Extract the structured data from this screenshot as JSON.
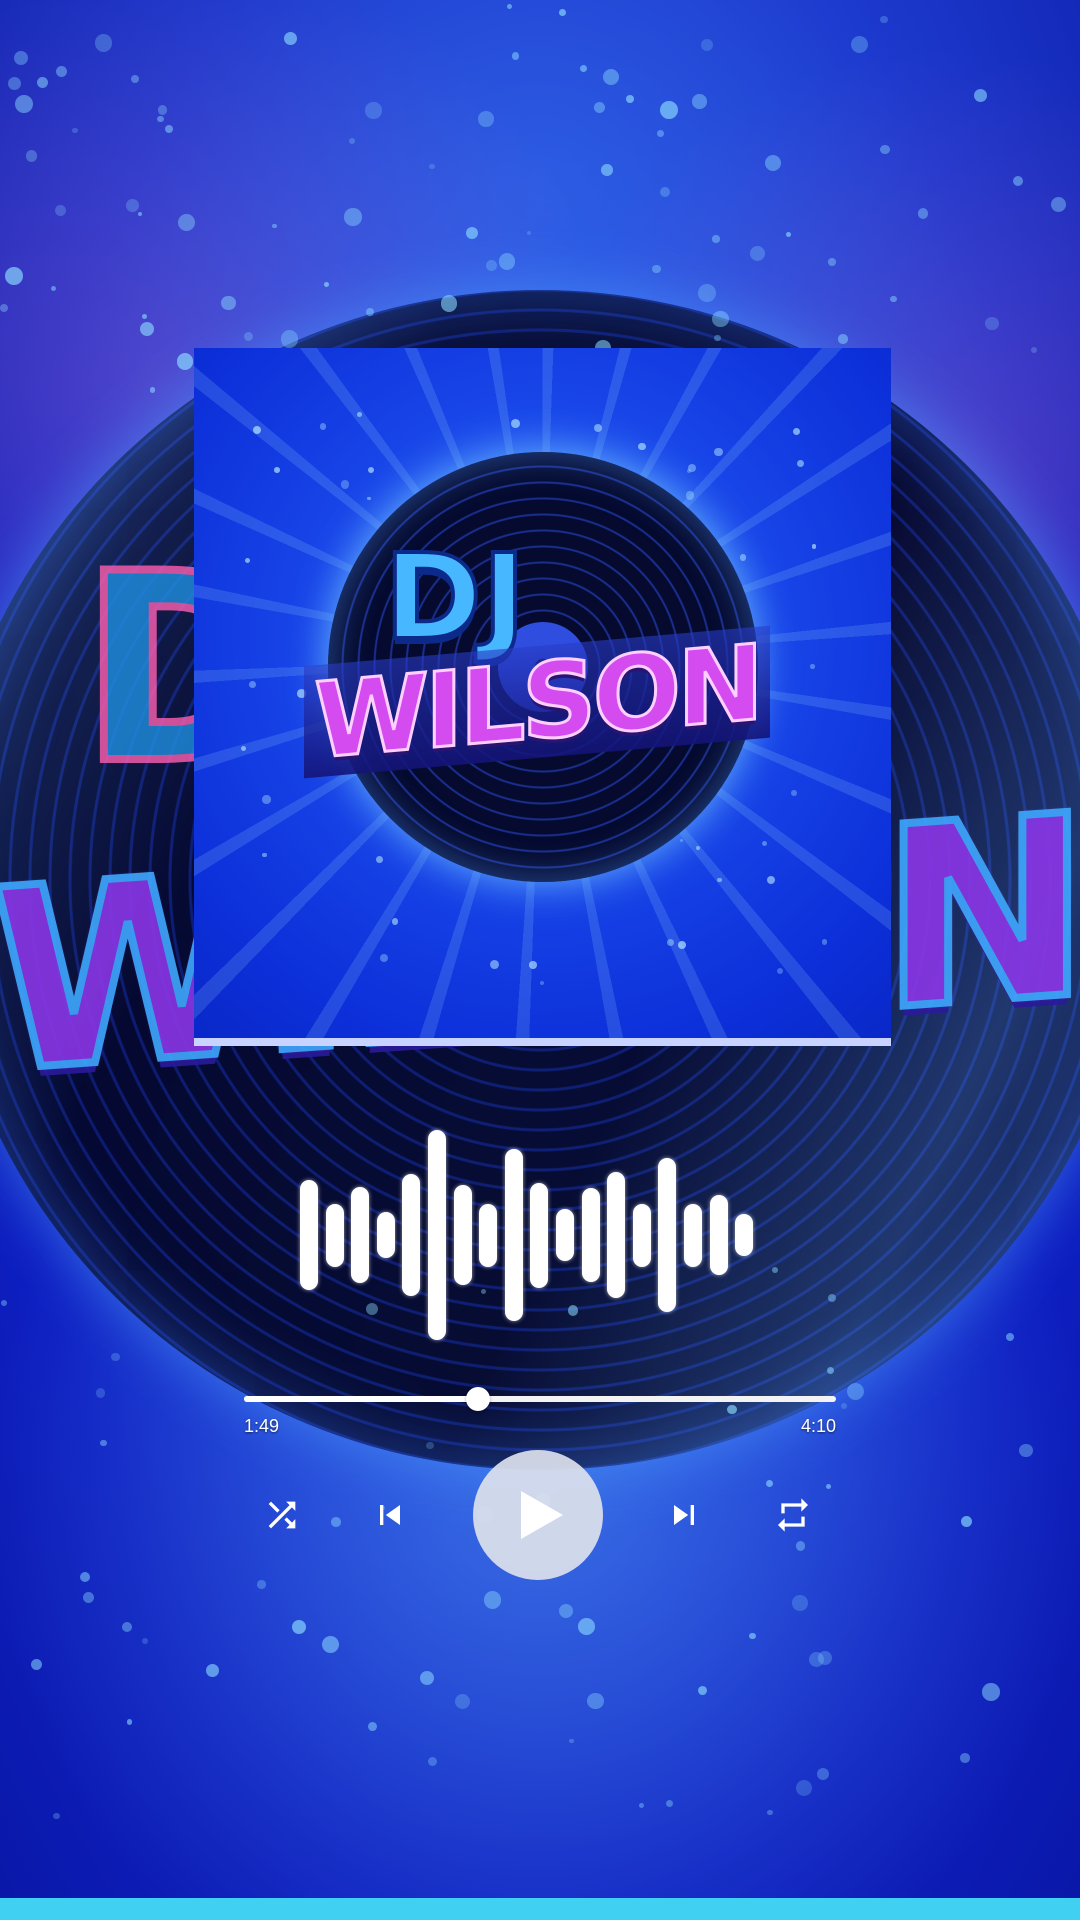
{
  "app": {
    "accent_color": "#1a3ee0",
    "bottom_bar_color": "#3fd0f2"
  },
  "background": {
    "art_text_top": "DJ",
    "art_text_bottom": "WILSON"
  },
  "album_art": {
    "title_top": "DJ",
    "title_bottom": "WILSON"
  },
  "visualizer": {
    "bar_levels": [
      0.52,
      0.3,
      0.46,
      0.22,
      0.58,
      1.0,
      0.48,
      0.3,
      0.82,
      0.5,
      0.25,
      0.45,
      0.6,
      0.3,
      0.73,
      0.3,
      0.38,
      0.2
    ]
  },
  "player": {
    "elapsed": "1:49",
    "total": "4:10",
    "progress_fraction": 0.395,
    "controls": {
      "shuffle_icon": "shuffle-icon",
      "previous_icon": "skip-previous-icon",
      "play_icon": "play-icon",
      "next_icon": "skip-next-icon",
      "repeat_icon": "repeat-icon"
    }
  }
}
